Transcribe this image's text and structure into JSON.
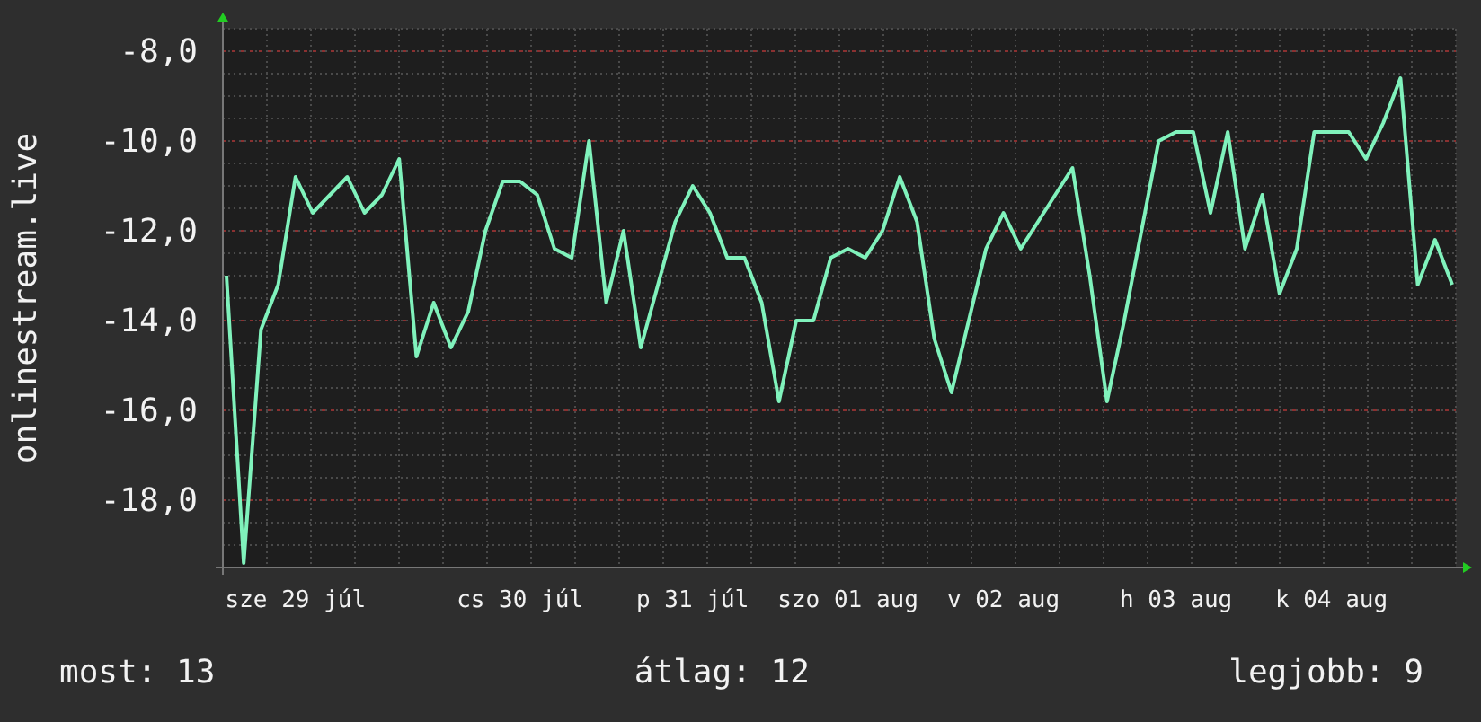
{
  "chart": {
    "chart_data": {
      "type": "line",
      "grid": true,
      "ylabel": "onlinestream.live",
      "ylim": [
        -19.5,
        -7.5
      ],
      "yticks": [
        {
          "value": -8,
          "label": "-8,0"
        },
        {
          "value": -10,
          "label": "-10,0"
        },
        {
          "value": -12,
          "label": "-12,0"
        },
        {
          "value": -14,
          "label": "-14,0"
        },
        {
          "value": -16,
          "label": "-16,0"
        },
        {
          "value": -18,
          "label": "-18,0"
        }
      ],
      "categories": [
        null,
        null,
        null,
        null,
        "sze 29 júl",
        null,
        null,
        null,
        null,
        null,
        null,
        null,
        null,
        null,
        null,
        null,
        null,
        "cs 30 júl",
        null,
        null,
        null,
        null,
        null,
        null,
        null,
        null,
        null,
        "p 31 júl",
        null,
        null,
        null,
        null,
        null,
        null,
        null,
        null,
        "szo 01 aug",
        null,
        null,
        null,
        null,
        null,
        null,
        null,
        null,
        "v 02 aug",
        null,
        null,
        null,
        null,
        null,
        null,
        null,
        null,
        null,
        "h 03 aug",
        null,
        null,
        null,
        null,
        null,
        null,
        null,
        null,
        "k 04 aug",
        null,
        null,
        null,
        null,
        null,
        null,
        null
      ],
      "series": [
        {
          "color": "#80f2bc",
          "values": [
            -13.0,
            -19.4,
            -14.2,
            -13.2,
            -10.8,
            -11.6,
            -11.2,
            -10.8,
            -11.6,
            -11.2,
            -10.4,
            -14.8,
            -13.6,
            -14.6,
            -13.8,
            -12.0,
            -10.9,
            -10.9,
            -11.2,
            -12.4,
            -12.6,
            -10.0,
            -13.6,
            -12.0,
            -14.6,
            -13.2,
            -11.8,
            -11.0,
            -11.6,
            -12.6,
            -12.6,
            -13.6,
            -15.8,
            -14.0,
            -14.0,
            -12.6,
            -12.4,
            -12.6,
            -12.0,
            -10.8,
            -11.8,
            -14.4,
            -15.6,
            -14.0,
            -12.4,
            -11.6,
            -12.4,
            -11.8,
            -11.2,
            -10.6,
            -13.0,
            -15.8,
            -14.0,
            -12.0,
            -10.0,
            -9.8,
            -9.8,
            -11.6,
            -9.8,
            -12.4,
            -11.2,
            -13.4,
            -12.4,
            -9.8,
            -9.8,
            -9.8,
            -10.4,
            -9.6,
            -8.6,
            -13.2,
            -12.2,
            -13.2
          ]
        }
      ]
    }
  },
  "stats": [
    {
      "text": "most: 13"
    },
    {
      "text": "átlag: 12"
    },
    {
      "text": "legjobb: 9"
    }
  ]
}
